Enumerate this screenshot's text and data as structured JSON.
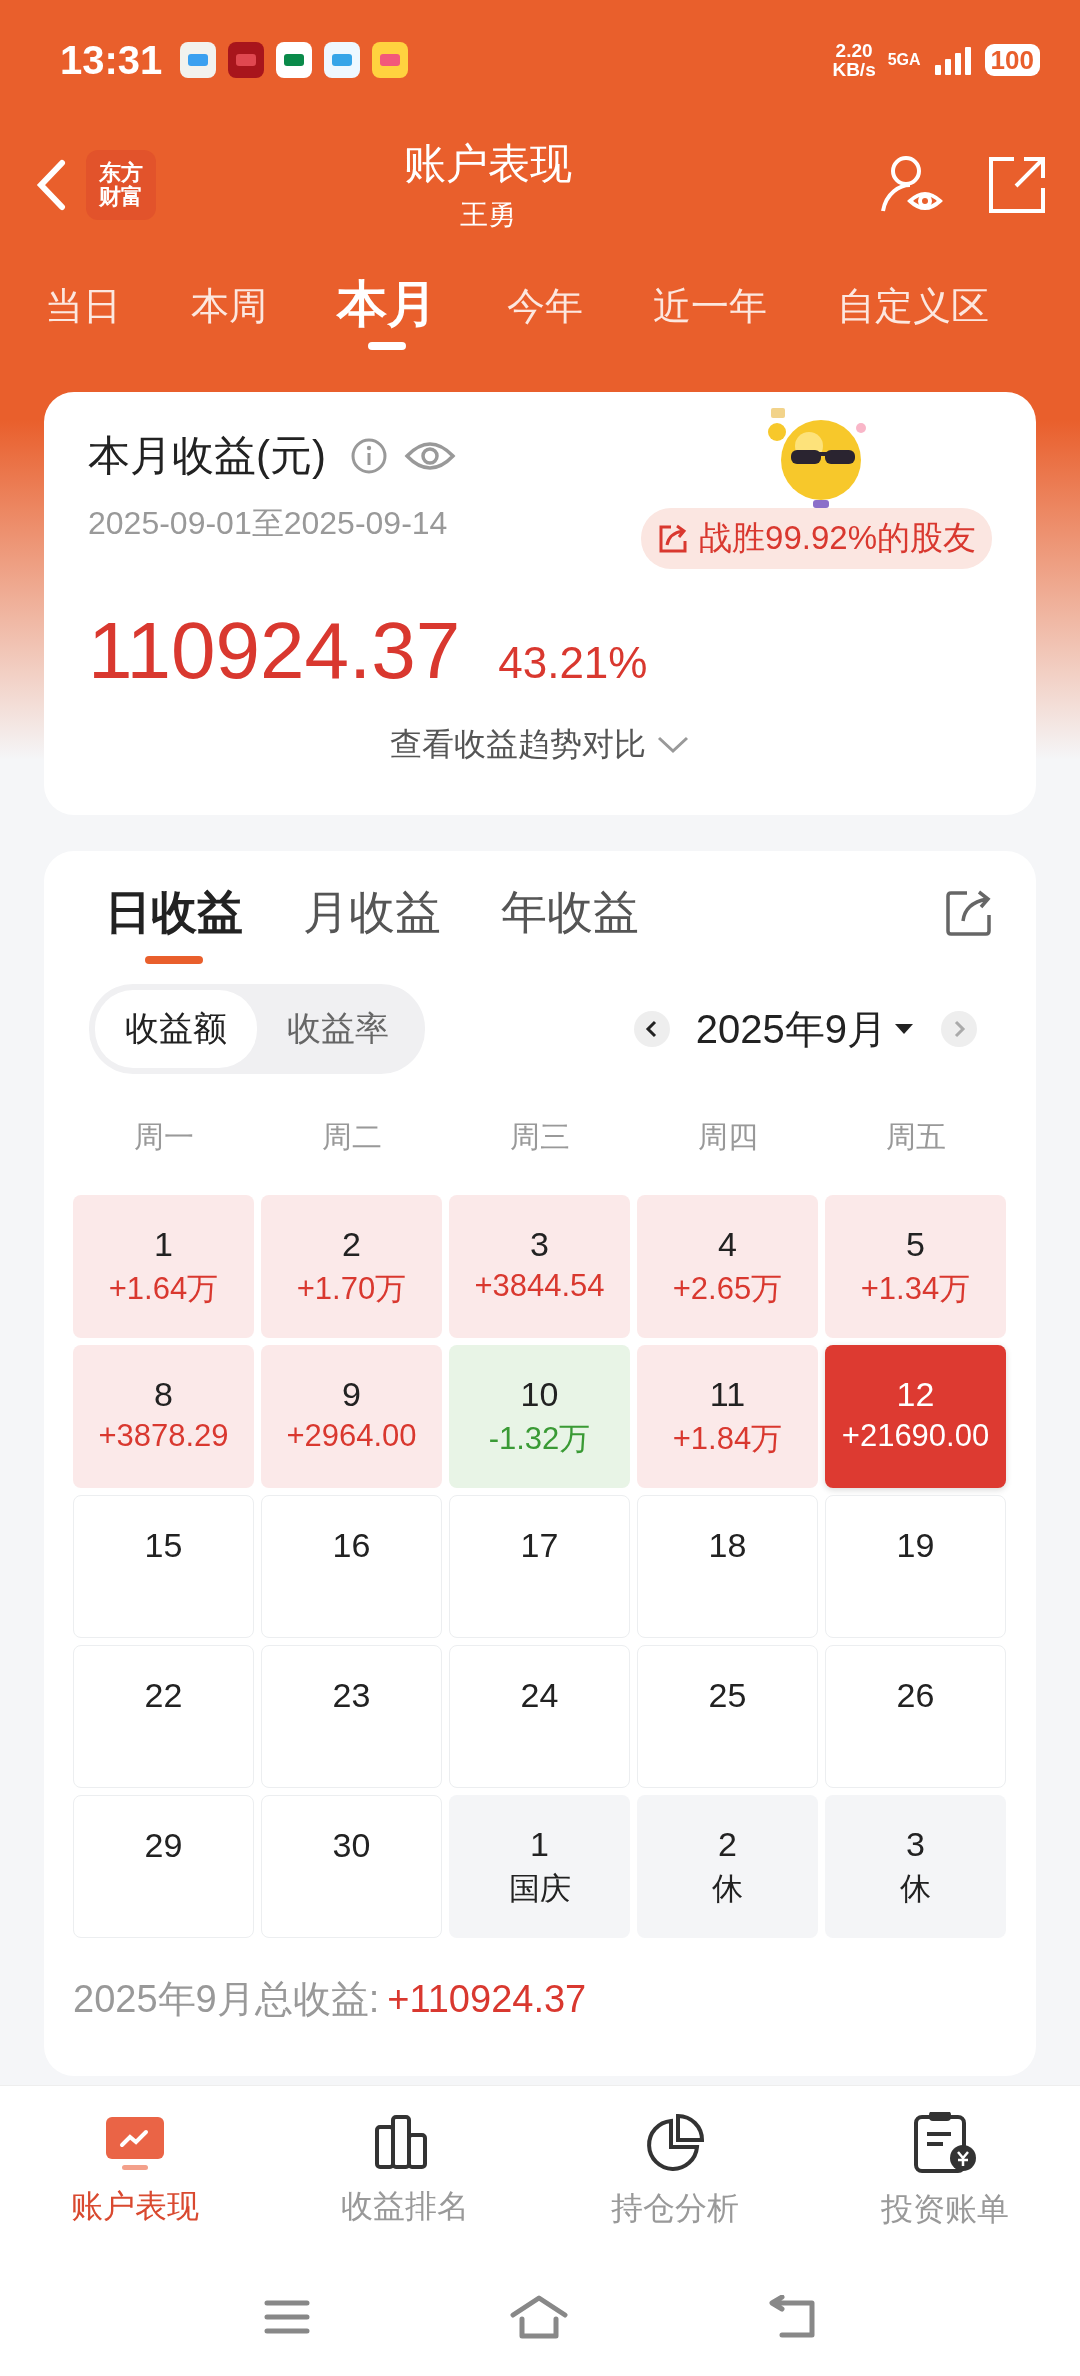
{
  "status_bar": {
    "time": "13:31",
    "net_speed": "2.20",
    "net_unit": "KB/s",
    "network": "5GA",
    "battery": "100"
  },
  "header": {
    "logo_lines": [
      "东方",
      "财富"
    ],
    "title": "账户表现",
    "subtitle": "王勇"
  },
  "period_tabs": [
    {
      "label": "当日",
      "selected": false
    },
    {
      "label": "本周",
      "selected": false
    },
    {
      "label": "本月",
      "selected": true
    },
    {
      "label": "今年",
      "selected": false
    },
    {
      "label": "近一年",
      "selected": false
    },
    {
      "label": "自定义区",
      "selected": false
    }
  ],
  "summary": {
    "title": "本月收益(元)",
    "date_range": "2025-09-01至2025-09-14",
    "rank_badge": "战胜99.92%的股友",
    "amount": "110924.37",
    "rate": "43.21%",
    "trend_link": "查看收益趋势对比"
  },
  "earnings": {
    "tabs": [
      {
        "label": "日收益",
        "selected": true
      },
      {
        "label": "月收益",
        "selected": false
      },
      {
        "label": "年收益",
        "selected": false
      }
    ],
    "mode_toggle": [
      {
        "label": "收益额",
        "selected": true
      },
      {
        "label": "收益率",
        "selected": false
      }
    ],
    "month": "2025年9月",
    "weekdays": [
      "周一",
      "周二",
      "周三",
      "周四",
      "周五"
    ],
    "days": [
      {
        "day": "1",
        "value": "+1.64万",
        "kind": "gain",
        "selected": false
      },
      {
        "day": "2",
        "value": "+1.70万",
        "kind": "gain",
        "selected": false
      },
      {
        "day": "3",
        "value": "+3844.54",
        "kind": "gain",
        "selected": false
      },
      {
        "day": "4",
        "value": "+2.65万",
        "kind": "gain",
        "selected": false
      },
      {
        "day": "5",
        "value": "+1.34万",
        "kind": "gain",
        "selected": false
      },
      {
        "day": "8",
        "value": "+3878.29",
        "kind": "gain",
        "selected": false
      },
      {
        "day": "9",
        "value": "+2964.00",
        "kind": "gain",
        "selected": false
      },
      {
        "day": "10",
        "value": "-1.32万",
        "kind": "loss",
        "selected": false
      },
      {
        "day": "11",
        "value": "+1.84万",
        "kind": "gain",
        "selected": false
      },
      {
        "day": "12",
        "value": "+21690.00",
        "kind": "gain",
        "selected": true
      },
      {
        "day": "15",
        "kind": "plain",
        "selected": false
      },
      {
        "day": "16",
        "kind": "plain",
        "selected": false
      },
      {
        "day": "17",
        "kind": "plain",
        "selected": false
      },
      {
        "day": "18",
        "kind": "plain",
        "selected": false
      },
      {
        "day": "19",
        "kind": "plain",
        "selected": false
      },
      {
        "day": "22",
        "kind": "plain",
        "selected": false
      },
      {
        "day": "23",
        "kind": "plain",
        "selected": false
      },
      {
        "day": "24",
        "kind": "plain",
        "selected": false
      },
      {
        "day": "25",
        "kind": "plain",
        "selected": false
      },
      {
        "day": "26",
        "kind": "plain",
        "selected": false
      },
      {
        "day": "29",
        "kind": "plain",
        "selected": false
      },
      {
        "day": "30",
        "kind": "plain",
        "selected": false
      },
      {
        "day": "1",
        "note": "国庆",
        "kind": "holiday",
        "selected": false
      },
      {
        "day": "2",
        "note": "休",
        "kind": "holiday",
        "selected": false
      },
      {
        "day": "3",
        "note": "休",
        "kind": "holiday",
        "selected": false
      }
    ],
    "total_label": "2025年9月总收益:",
    "total_value": "+110924.37"
  },
  "bottom_nav": [
    {
      "label": "账户表现",
      "selected": true
    },
    {
      "label": "收益排名",
      "selected": false
    },
    {
      "label": "持仓分析",
      "selected": false
    },
    {
      "label": "投资账单",
      "selected": false
    }
  ]
}
